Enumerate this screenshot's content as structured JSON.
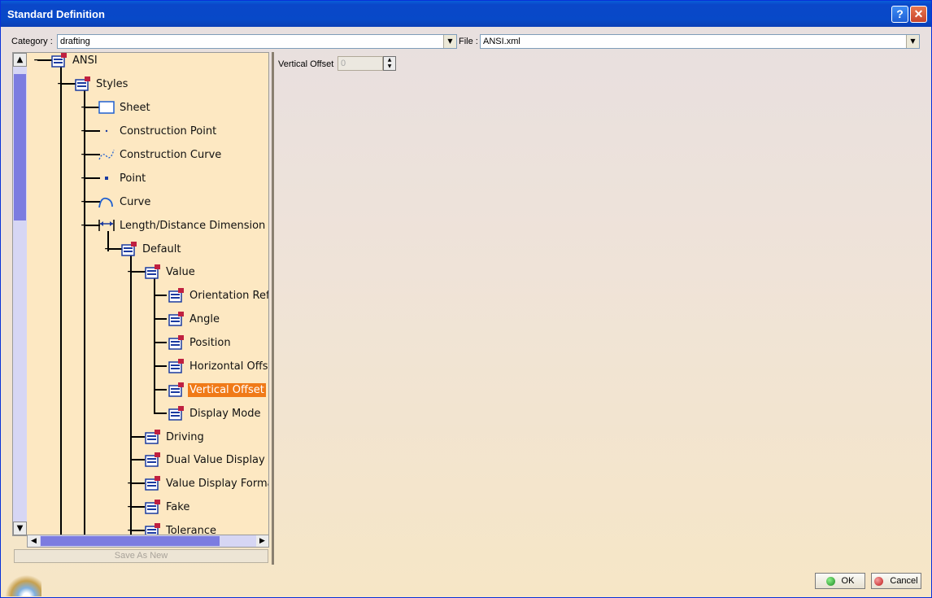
{
  "window": {
    "title": "Standard Definition",
    "help_label": "?",
    "close_label": "✕"
  },
  "category": {
    "label": "Category :",
    "value": "drafting"
  },
  "file": {
    "label": "File :",
    "value": "ANSI.xml"
  },
  "tree": {
    "root": "ANSI",
    "styles": "Styles",
    "items": [
      {
        "label": "Sheet"
      },
      {
        "label": "Construction Point"
      },
      {
        "label": "Construction Curve"
      },
      {
        "label": "Point"
      },
      {
        "label": "Curve"
      },
      {
        "label": "Length/Distance Dimension"
      }
    ],
    "default": "Default",
    "value": "Value",
    "value_children": [
      {
        "label": "Orientation Refe"
      },
      {
        "label": "Angle"
      },
      {
        "label": "Position"
      },
      {
        "label": "Horizontal Offset"
      },
      {
        "label": "Vertical Offset",
        "selected": true
      },
      {
        "label": "Display Mode"
      }
    ],
    "default_children": [
      {
        "label": "Driving"
      },
      {
        "label": "Dual Value Display"
      },
      {
        "label": "Value Display Format"
      },
      {
        "label": "Fake"
      },
      {
        "label": "Tolerance"
      }
    ]
  },
  "save_as_new": "Save As New",
  "vertical_offset": {
    "label": "Vertical Offset",
    "value": "0"
  },
  "buttons": {
    "ok": "OK",
    "cancel": "Cancel"
  },
  "colors": {
    "selection": "#f07a18",
    "panel": "#fde8c2",
    "titlebar": "#0a47c9"
  }
}
